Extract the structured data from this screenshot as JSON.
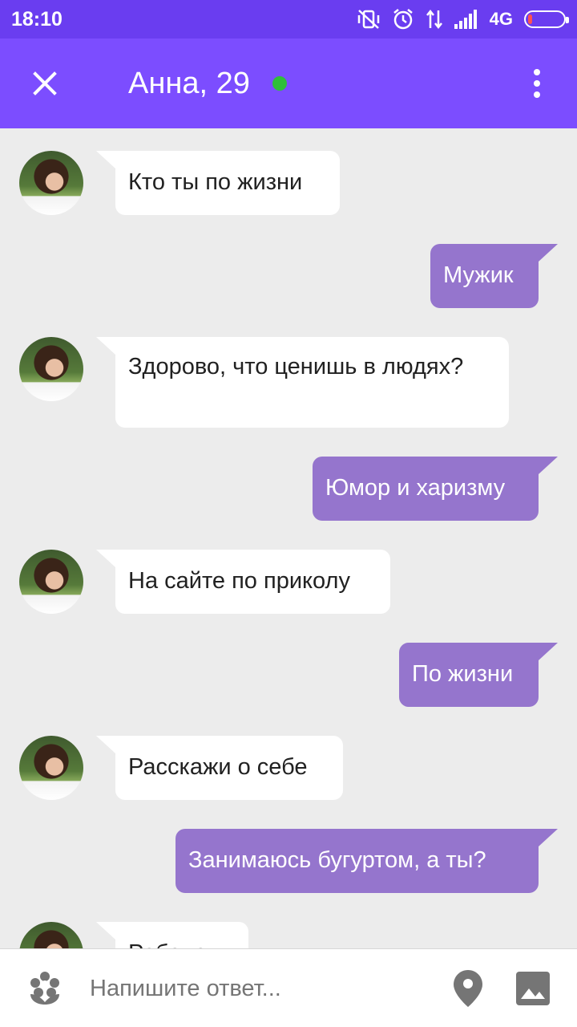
{
  "status_bar": {
    "time": "18:10",
    "network": "4G"
  },
  "header": {
    "title": "Анна, 29",
    "online": true,
    "online_color": "#2fbf3a",
    "accent_color": "#7c4dff"
  },
  "messages": [
    {
      "side": "in",
      "text": "Кто ты по жизни"
    },
    {
      "side": "out",
      "text": "Мужик"
    },
    {
      "side": "in",
      "text": "Здорово, что ценишь в людях?"
    },
    {
      "side": "out",
      "text": "Юмор и харизму"
    },
    {
      "side": "in",
      "text": "На сайте по приколу"
    },
    {
      "side": "out",
      "text": "По жизни"
    },
    {
      "side": "in",
      "text": "Расскажи о себе"
    },
    {
      "side": "out",
      "text": "Занимаюсь бугуртом, а ты?"
    },
    {
      "side": "in",
      "text": "Ребенок"
    }
  ],
  "composer": {
    "placeholder": "Напишите ответ...",
    "icons": [
      "sticker-icon",
      "location-icon",
      "photo-icon"
    ]
  }
}
